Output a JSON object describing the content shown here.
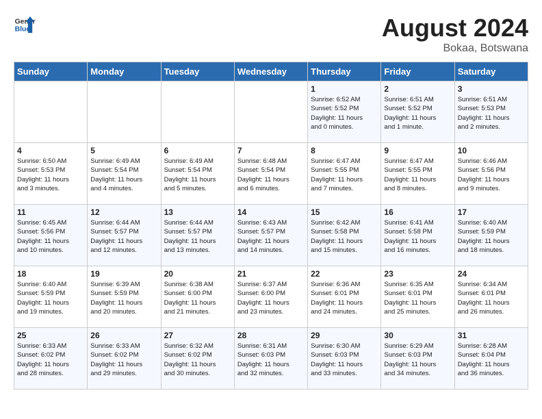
{
  "header": {
    "logo_line1": "General",
    "logo_line2": "Blue",
    "month_year": "August 2024",
    "location": "Bokaa, Botswana"
  },
  "days_of_week": [
    "Sunday",
    "Monday",
    "Tuesday",
    "Wednesday",
    "Thursday",
    "Friday",
    "Saturday"
  ],
  "weeks": [
    [
      {
        "day": "",
        "detail": ""
      },
      {
        "day": "",
        "detail": ""
      },
      {
        "day": "",
        "detail": ""
      },
      {
        "day": "",
        "detail": ""
      },
      {
        "day": "1",
        "detail": "Sunrise: 6:52 AM\nSunset: 5:52 PM\nDaylight: 11 hours\nand 0 minutes."
      },
      {
        "day": "2",
        "detail": "Sunrise: 6:51 AM\nSunset: 5:52 PM\nDaylight: 11 hours\nand 1 minute."
      },
      {
        "day": "3",
        "detail": "Sunrise: 6:51 AM\nSunset: 5:53 PM\nDaylight: 11 hours\nand 2 minutes."
      }
    ],
    [
      {
        "day": "4",
        "detail": "Sunrise: 6:50 AM\nSunset: 5:53 PM\nDaylight: 11 hours\nand 3 minutes."
      },
      {
        "day": "5",
        "detail": "Sunrise: 6:49 AM\nSunset: 5:54 PM\nDaylight: 11 hours\nand 4 minutes."
      },
      {
        "day": "6",
        "detail": "Sunrise: 6:49 AM\nSunset: 5:54 PM\nDaylight: 11 hours\nand 5 minutes."
      },
      {
        "day": "7",
        "detail": "Sunrise: 6:48 AM\nSunset: 5:54 PM\nDaylight: 11 hours\nand 6 minutes."
      },
      {
        "day": "8",
        "detail": "Sunrise: 6:47 AM\nSunset: 5:55 PM\nDaylight: 11 hours\nand 7 minutes."
      },
      {
        "day": "9",
        "detail": "Sunrise: 6:47 AM\nSunset: 5:55 PM\nDaylight: 11 hours\nand 8 minutes."
      },
      {
        "day": "10",
        "detail": "Sunrise: 6:46 AM\nSunset: 5:56 PM\nDaylight: 11 hours\nand 9 minutes."
      }
    ],
    [
      {
        "day": "11",
        "detail": "Sunrise: 6:45 AM\nSunset: 5:56 PM\nDaylight: 11 hours\nand 10 minutes."
      },
      {
        "day": "12",
        "detail": "Sunrise: 6:44 AM\nSunset: 5:57 PM\nDaylight: 11 hours\nand 12 minutes."
      },
      {
        "day": "13",
        "detail": "Sunrise: 6:44 AM\nSunset: 5:57 PM\nDaylight: 11 hours\nand 13 minutes."
      },
      {
        "day": "14",
        "detail": "Sunrise: 6:43 AM\nSunset: 5:57 PM\nDaylight: 11 hours\nand 14 minutes."
      },
      {
        "day": "15",
        "detail": "Sunrise: 6:42 AM\nSunset: 5:58 PM\nDaylight: 11 hours\nand 15 minutes."
      },
      {
        "day": "16",
        "detail": "Sunrise: 6:41 AM\nSunset: 5:58 PM\nDaylight: 11 hours\nand 16 minutes."
      },
      {
        "day": "17",
        "detail": "Sunrise: 6:40 AM\nSunset: 5:59 PM\nDaylight: 11 hours\nand 18 minutes."
      }
    ],
    [
      {
        "day": "18",
        "detail": "Sunrise: 6:40 AM\nSunset: 5:59 PM\nDaylight: 11 hours\nand 19 minutes."
      },
      {
        "day": "19",
        "detail": "Sunrise: 6:39 AM\nSunset: 5:59 PM\nDaylight: 11 hours\nand 20 minutes."
      },
      {
        "day": "20",
        "detail": "Sunrise: 6:38 AM\nSunset: 6:00 PM\nDaylight: 11 hours\nand 21 minutes."
      },
      {
        "day": "21",
        "detail": "Sunrise: 6:37 AM\nSunset: 6:00 PM\nDaylight: 11 hours\nand 23 minutes."
      },
      {
        "day": "22",
        "detail": "Sunrise: 6:36 AM\nSunset: 6:01 PM\nDaylight: 11 hours\nand 24 minutes."
      },
      {
        "day": "23",
        "detail": "Sunrise: 6:35 AM\nSunset: 6:01 PM\nDaylight: 11 hours\nand 25 minutes."
      },
      {
        "day": "24",
        "detail": "Sunrise: 6:34 AM\nSunset: 6:01 PM\nDaylight: 11 hours\nand 26 minutes."
      }
    ],
    [
      {
        "day": "25",
        "detail": "Sunrise: 6:33 AM\nSunset: 6:02 PM\nDaylight: 11 hours\nand 28 minutes."
      },
      {
        "day": "26",
        "detail": "Sunrise: 6:33 AM\nSunset: 6:02 PM\nDaylight: 11 hours\nand 29 minutes."
      },
      {
        "day": "27",
        "detail": "Sunrise: 6:32 AM\nSunset: 6:02 PM\nDaylight: 11 hours\nand 30 minutes."
      },
      {
        "day": "28",
        "detail": "Sunrise: 6:31 AM\nSunset: 6:03 PM\nDaylight: 11 hours\nand 32 minutes."
      },
      {
        "day": "29",
        "detail": "Sunrise: 6:30 AM\nSunset: 6:03 PM\nDaylight: 11 hours\nand 33 minutes."
      },
      {
        "day": "30",
        "detail": "Sunrise: 6:29 AM\nSunset: 6:03 PM\nDaylight: 11 hours\nand 34 minutes."
      },
      {
        "day": "31",
        "detail": "Sunrise: 6:28 AM\nSunset: 6:04 PM\nDaylight: 11 hours\nand 36 minutes."
      }
    ]
  ]
}
